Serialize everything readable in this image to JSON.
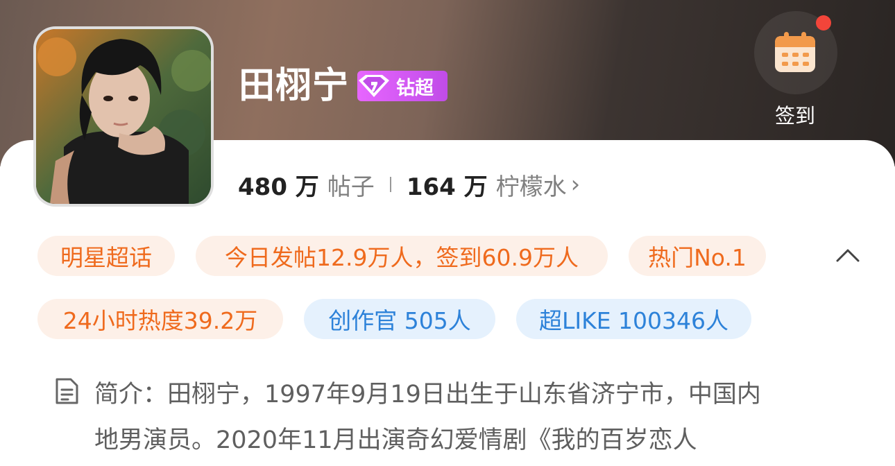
{
  "header": {
    "title": "田栩宁",
    "badge_label": "钻超",
    "checkin_label": "签到"
  },
  "stats": {
    "posts_num": "480 万",
    "posts_label": "帖子",
    "lemon_num": "164 万",
    "lemon_label": "柠檬水",
    "chevron": "›"
  },
  "tags": [
    {
      "label": "明星超话",
      "style": "orange"
    },
    {
      "label": "今日发帖12.9万人，签到60.9万人",
      "style": "orange"
    },
    {
      "label": "热门No.1",
      "style": "orange"
    },
    {
      "label": "24小时热度39.2万",
      "style": "orange"
    },
    {
      "label": "创作官 505人",
      "style": "blue"
    },
    {
      "label": "超LIKE 100346人",
      "style": "blue"
    }
  ],
  "intro": {
    "line1": "简介：田栩宁，1997年9月19日出生于山东省济宁市，中国内",
    "line2": "地男演员。2020年11月出演奇幻爱情剧《我的百岁恋人"
  },
  "icons": {
    "calendar": "calendar-icon",
    "collapse": "chevron-up-icon",
    "document": "document-icon",
    "gem": "diamond-icon"
  },
  "colors": {
    "tag_orange_bg": "#fdf0e8",
    "tag_orange_text": "#ef6a1d",
    "tag_blue_bg": "#e5f1fd",
    "tag_blue_text": "#2d82d9",
    "badge_purple": "#d05cf0",
    "notify_red": "#f2453a"
  }
}
